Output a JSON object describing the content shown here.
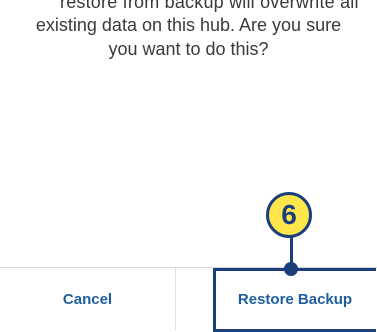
{
  "dialog": {
    "message_cutoff": "restore from backup will overwrite all",
    "message": "existing data on this hub. Are you sure you want to do this?",
    "cancel_label": "Cancel",
    "restore_label": "Restore Backup"
  },
  "callout": {
    "number": "6",
    "badge_color": "#ffe64a",
    "outline_color": "#1b3f7a"
  },
  "colors": {
    "button_text": "#1f5e9e",
    "message_text": "#3a3a3a"
  }
}
